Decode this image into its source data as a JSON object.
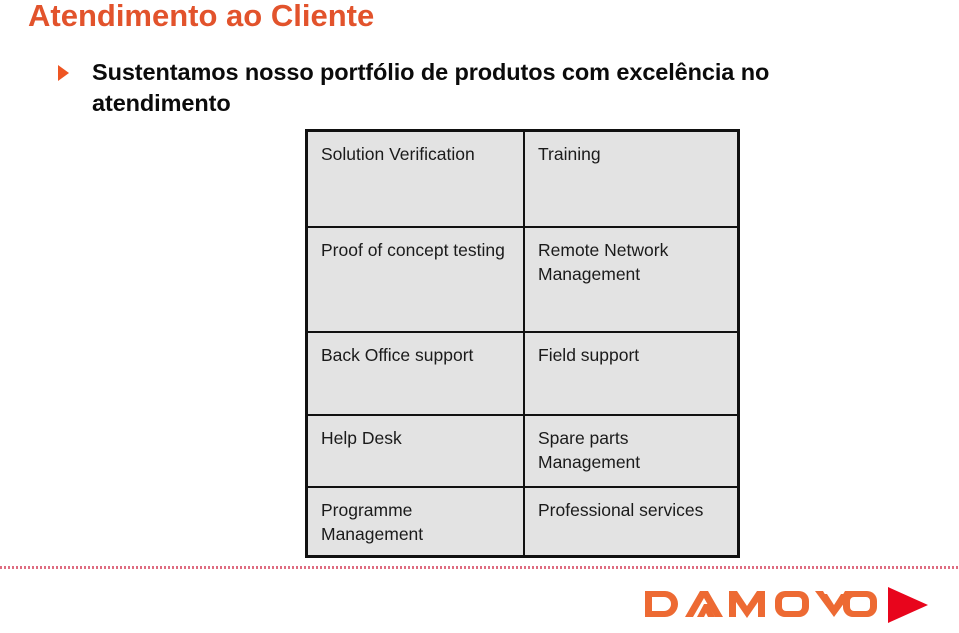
{
  "slide": {
    "title": "Atendimento ao Cliente",
    "title_color": "#E2532C",
    "bullet_marker_color": "#EE5522",
    "bullet_text": "Sustentamos nosso portfólio de produtos com excelência no atendimento"
  },
  "services_table": {
    "background_color": "#E3E3E3",
    "border_color": "#111111",
    "rows": [
      {
        "left": "Solution Verification",
        "right": "Training"
      },
      {
        "left": "Proof of concept testing",
        "right": "Remote Network Management"
      },
      {
        "left": "Back Office support",
        "right": "Field support"
      },
      {
        "left": "Help Desk",
        "right": "Spare parts Management"
      },
      {
        "left": "Programme Management",
        "right": "Professional services"
      }
    ]
  },
  "footer": {
    "divider_color": "#D9536B",
    "logo": {
      "wordmark": "DAMOVO",
      "wordmark_color": "#ED6A33",
      "triangle_color": "#E8051C"
    }
  }
}
